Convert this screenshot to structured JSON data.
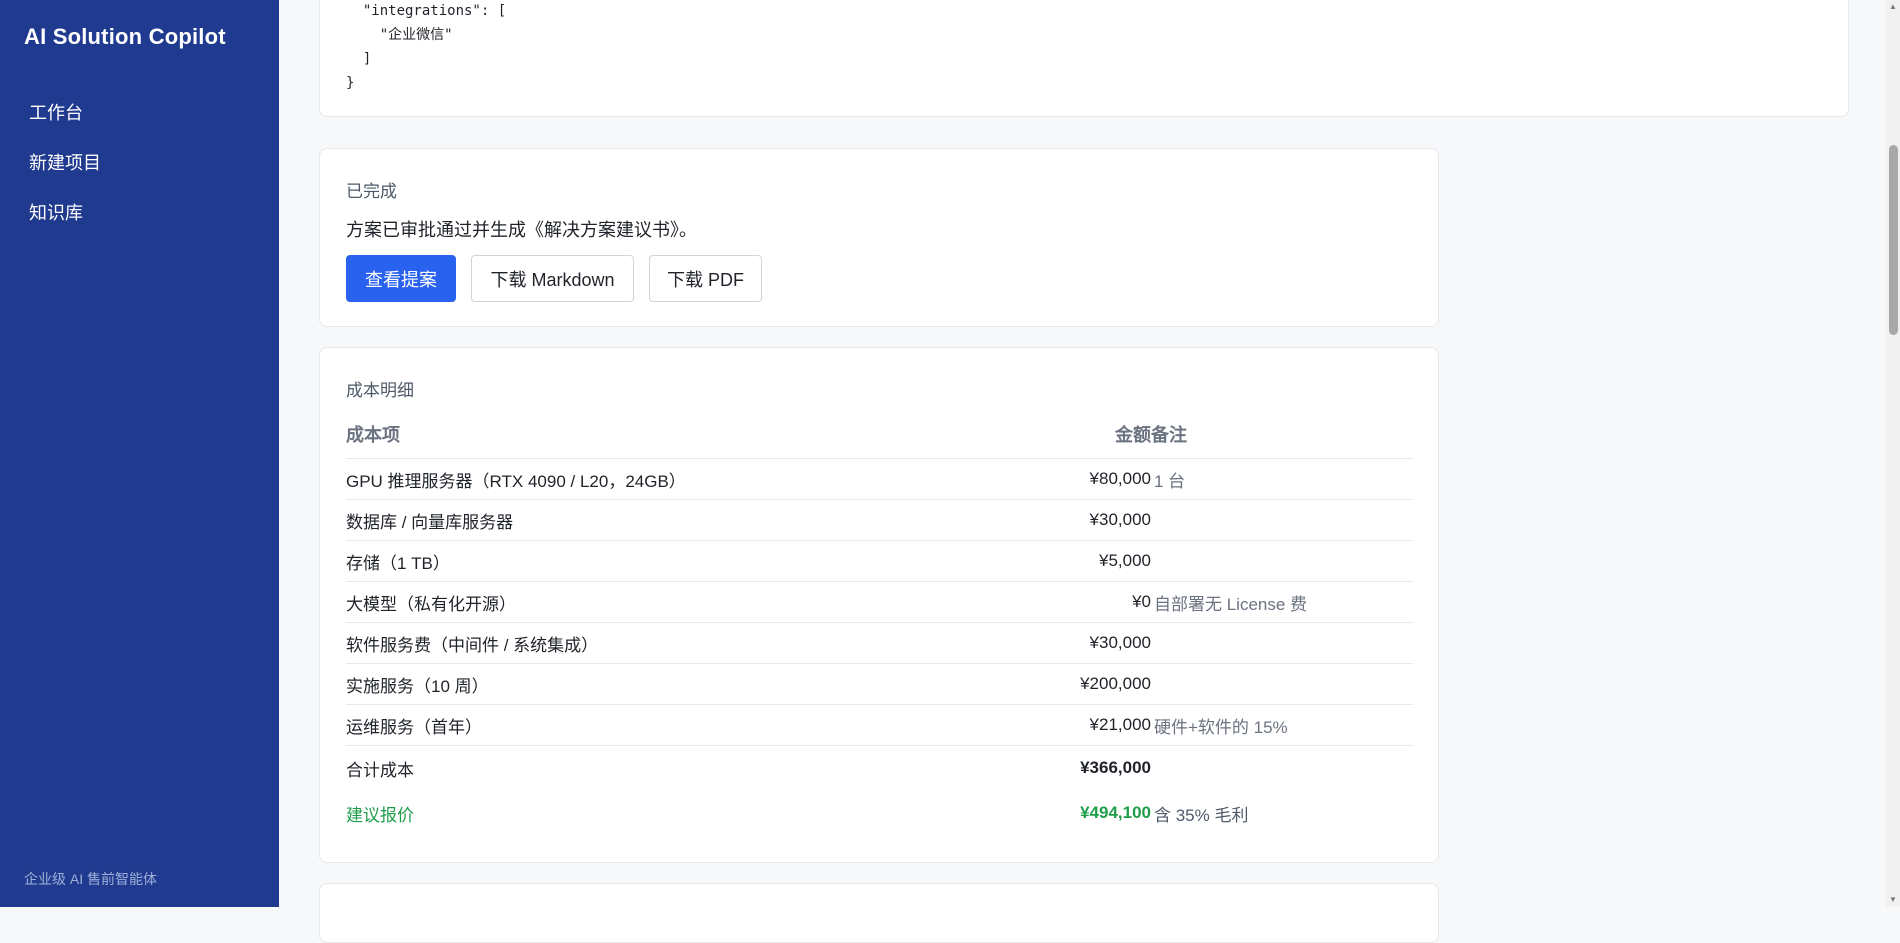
{
  "sidebar": {
    "brand": "AI Solution Copilot",
    "items": [
      {
        "label": "工作台"
      },
      {
        "label": "新建项目"
      },
      {
        "label": "知识库"
      }
    ],
    "footer": "企业级 AI 售前智能体"
  },
  "code_snippet": {
    "lines": [
      "  \"integrations\": [",
      "    \"企业微信\"",
      "  ]",
      "}"
    ]
  },
  "done": {
    "label": "已完成",
    "description": "方案已审批通过并生成《解决方案建议书》。",
    "buttons": {
      "view": "查看提案",
      "markdown": "下载 Markdown",
      "pdf": "下载 PDF"
    }
  },
  "cost": {
    "label": "成本明细",
    "headers": {
      "item": "成本项",
      "amount": "金额",
      "note": "备注"
    },
    "rows": [
      {
        "item": "GPU 推理服务器（RTX 4090 / L20，24GB）",
        "amount": "¥80,000",
        "note": "1 台"
      },
      {
        "item": "数据库 / 向量库服务器",
        "amount": "¥30,000",
        "note": ""
      },
      {
        "item": "存储（1 TB）",
        "amount": "¥5,000",
        "note": ""
      },
      {
        "item": "大模型（私有化开源）",
        "amount": "¥0",
        "note": "自部署无 License 费"
      },
      {
        "item": "软件服务费（中间件 / 系统集成）",
        "amount": "¥30,000",
        "note": ""
      },
      {
        "item": "实施服务（10 周）",
        "amount": "¥200,000",
        "note": ""
      },
      {
        "item": "运维服务（首年）",
        "amount": "¥21,000",
        "note": "硬件+软件的 15%"
      }
    ],
    "total": {
      "item": "合计成本",
      "amount": "¥366,000",
      "note": ""
    },
    "suggested": {
      "item": "建议报价",
      "amount": "¥494,100",
      "note": "含 35% 毛利"
    }
  },
  "colors": {
    "sidebar_bg": "#1f3a8f",
    "primary": "#2a62f0",
    "success": "#1e9e4a"
  }
}
